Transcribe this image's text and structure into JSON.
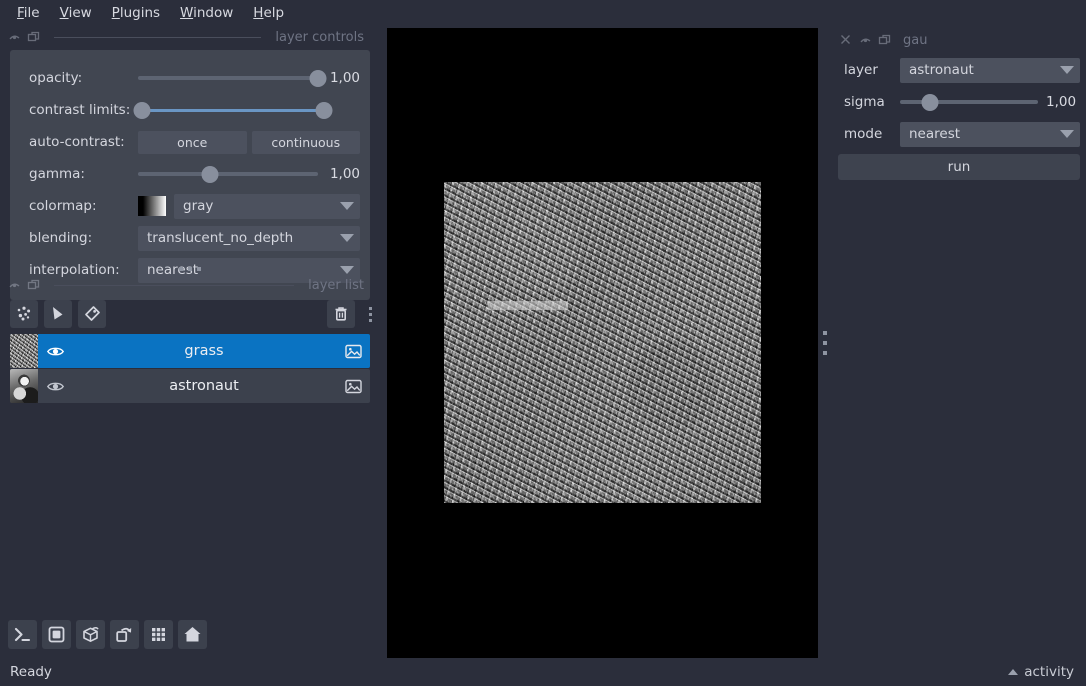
{
  "app": {
    "background_color": "#2b2e3b",
    "panel_color": "#414651",
    "accent_color": "#0a73c2",
    "slider_fill_color": "#6a96c4"
  },
  "menubar": {
    "items": [
      {
        "label": "File",
        "mnemonic": "F"
      },
      {
        "label": "View",
        "mnemonic": "V"
      },
      {
        "label": "Plugins",
        "mnemonic": "P"
      },
      {
        "label": "Window",
        "mnemonic": "W"
      },
      {
        "label": "Help",
        "mnemonic": "H"
      }
    ]
  },
  "layer_controls": {
    "dock_title": "layer controls",
    "opacity": {
      "label": "opacity:",
      "value": "1,00",
      "percent": 100
    },
    "contrast_limits": {
      "label": "contrast limits:",
      "low_percent": 0,
      "high_percent": 100
    },
    "auto_contrast": {
      "label": "auto-contrast:",
      "once_label": "once",
      "continuous_label": "continuous"
    },
    "gamma": {
      "label": "gamma:",
      "value": "1,00",
      "percent": 40
    },
    "colormap": {
      "label": "colormap:",
      "value": "gray"
    },
    "blending": {
      "label": "blending:",
      "value": "translucent_no_depth"
    },
    "interpolation": {
      "label": "interpolation:",
      "value": "nearest"
    }
  },
  "layer_list": {
    "dock_title": "layer list",
    "toolbar": {
      "points_icon": "points-layer-icon",
      "shapes_icon": "shapes-layer-icon",
      "labels_icon": "labels-layer-icon",
      "delete_icon": "trash-icon"
    },
    "layers": [
      {
        "name": "grass",
        "selected": true,
        "visible": true,
        "type_icon": "image-layer-icon",
        "thumbnail": "grass-thumbnail"
      },
      {
        "name": "astronaut",
        "selected": false,
        "visible": true,
        "type_icon": "image-layer-icon",
        "thumbnail": "astronaut-thumbnail"
      }
    ]
  },
  "viewer_buttons": [
    {
      "name": "console-button",
      "icon": "console-icon"
    },
    {
      "name": "ndisplay-2d-button",
      "icon": "square-icon"
    },
    {
      "name": "ndisplay-3d-button",
      "icon": "cube-icon"
    },
    {
      "name": "roll-dims-button",
      "icon": "roll-icon"
    },
    {
      "name": "grid-view-button",
      "icon": "grid-icon"
    },
    {
      "name": "reset-view-button",
      "icon": "home-icon"
    }
  ],
  "plugin_dock": {
    "title": "gau",
    "layer": {
      "label": "layer",
      "value": "astronaut"
    },
    "sigma": {
      "label": "sigma",
      "value": "1,00",
      "percent": 22
    },
    "mode": {
      "label": "mode",
      "value": "nearest"
    },
    "run_label": "run"
  },
  "statusbar": {
    "status": "Ready",
    "activity_label": "activity"
  }
}
